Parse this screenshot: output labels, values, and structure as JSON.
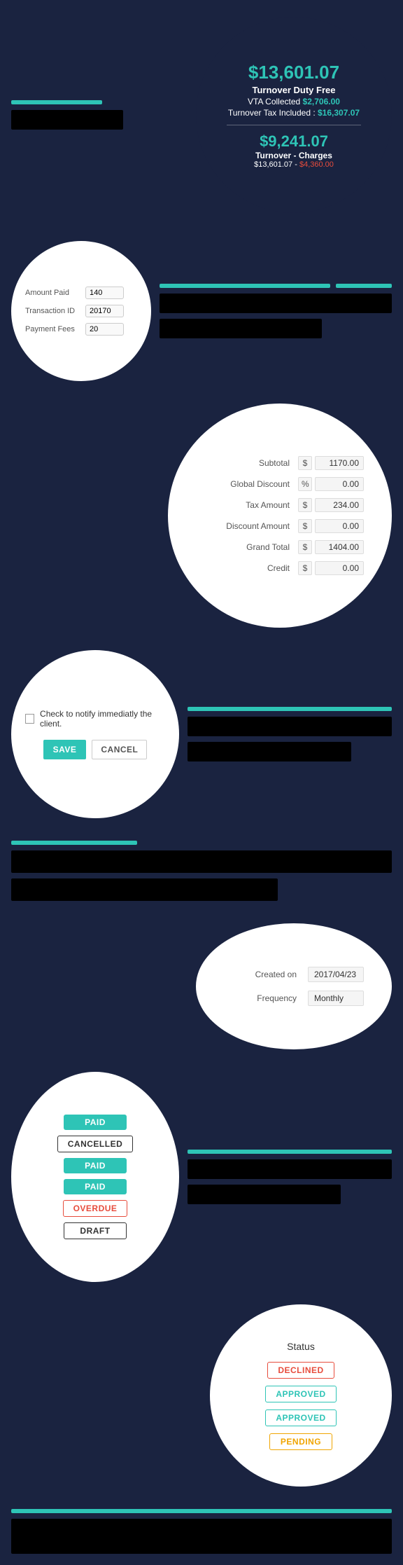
{
  "turnover": {
    "amount1": "$13,601.07",
    "label1": "Turnover Duty Free",
    "vta_label": "VTA Collected",
    "vta_amount": "$2,706.00",
    "tax_label": "Turnover Tax Included :",
    "tax_amount": "$16,307.07",
    "amount2": "$9,241.07",
    "label2": "Turnover - Charges",
    "calc": "$13,601.07",
    "minus": " - ",
    "charges": "$4,360.00"
  },
  "payment": {
    "amount_paid_label": "Amount Paid",
    "amount_paid_value": "140",
    "transaction_id_label": "Transaction ID",
    "transaction_id_value": "20170",
    "payment_fees_label": "Payment Fees",
    "payment_fees_value": "20"
  },
  "totals": {
    "subtotal_label": "Subtotal",
    "subtotal_value": "1170.00",
    "global_discount_label": "Global Discount",
    "global_discount_pct": "0.00",
    "tax_amount_label": "Tax Amount",
    "tax_amount_value": "234.00",
    "discount_amount_label": "Discount Amount",
    "discount_amount_value": "0.00",
    "grand_total_label": "Grand Total",
    "grand_total_value": "1404.00",
    "credit_label": "Credit",
    "credit_value": "0.00",
    "currency_symbol": "$",
    "pct_symbol": "%"
  },
  "notify": {
    "checkbox_label": "Check to notify immediatly the client.",
    "save_btn": "SAVE",
    "cancel_btn": "CANCEL"
  },
  "frequency": {
    "created_on_label": "Created on",
    "created_on_value": "2017/04/23",
    "frequency_label": "Frequency",
    "frequency_value": "Monthly"
  },
  "badges": {
    "paid1": "PAID",
    "cancelled": "CANCELLED",
    "paid2": "PAID",
    "paid3": "PAID",
    "overdue": "OVERDUE",
    "draft": "DRAFT"
  },
  "status": {
    "title": "Status",
    "declined": "DECLINED",
    "approved1": "APPROVED",
    "approved2": "APPROVED",
    "pending": "PENDING"
  }
}
